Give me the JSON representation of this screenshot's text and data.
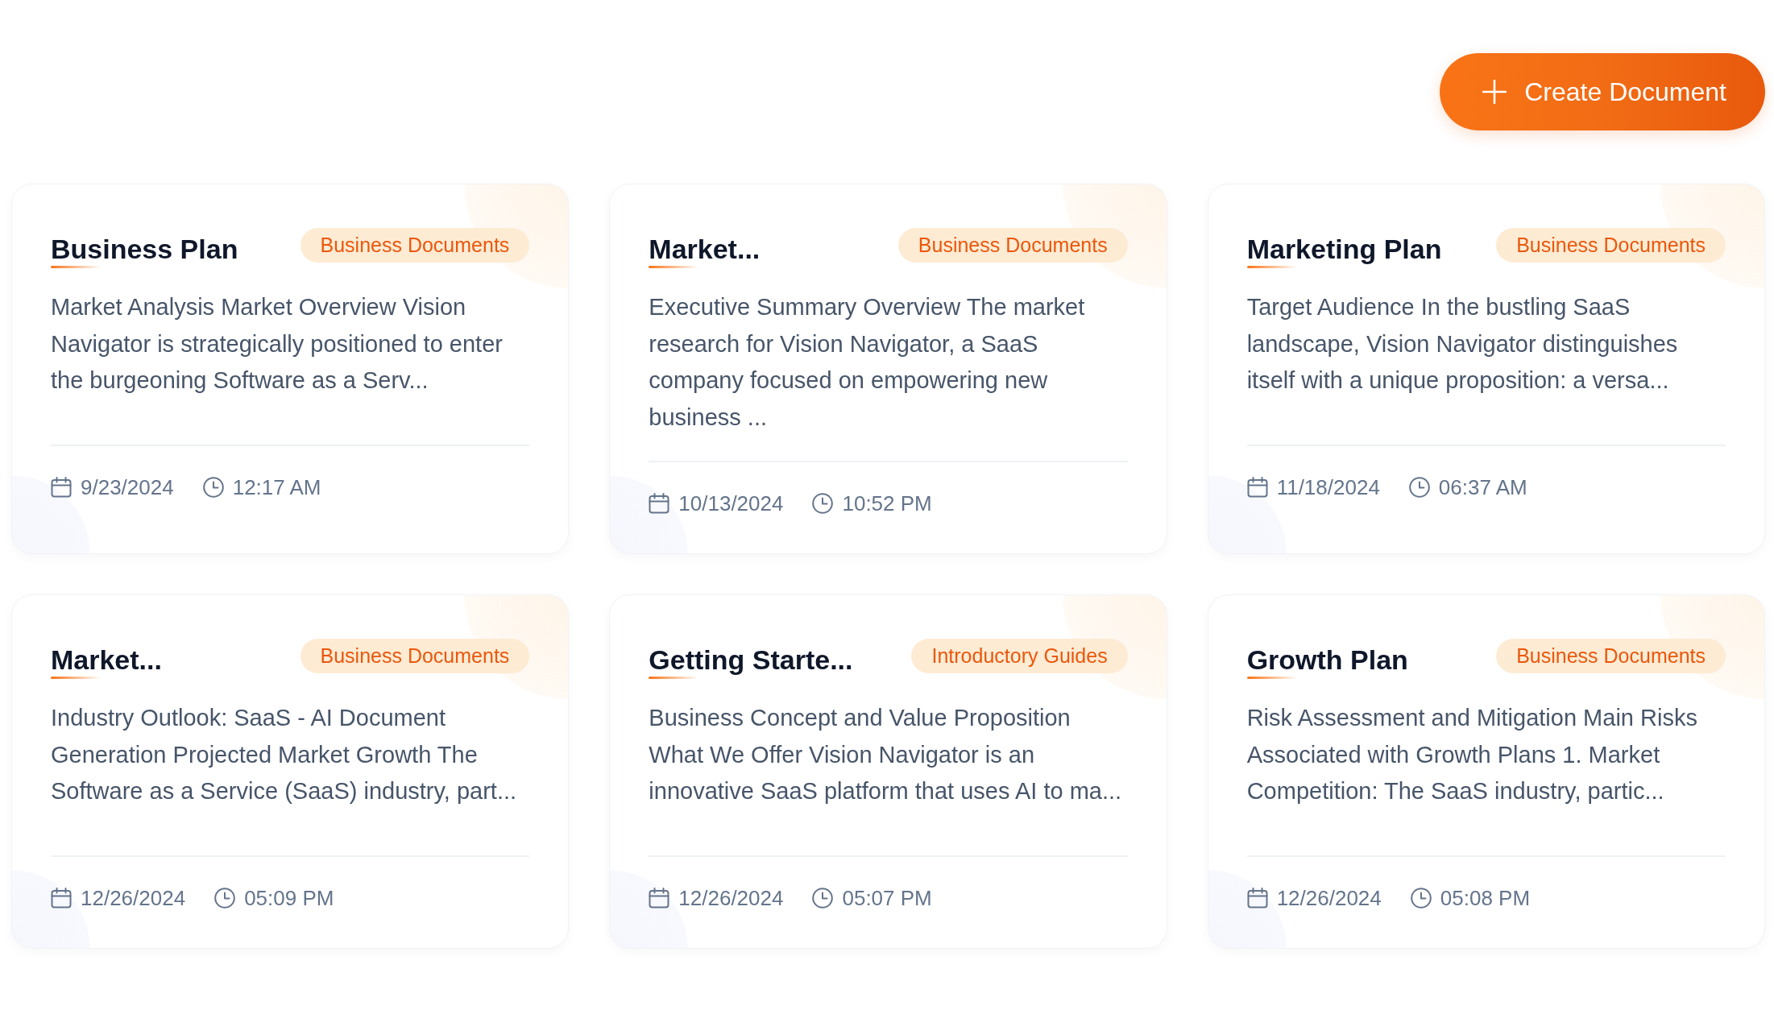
{
  "toolbar": {
    "create_button": {
      "label": "Create Document"
    }
  },
  "documents": [
    {
      "title": "Business Plan",
      "category": "Business Documents",
      "excerpt": "Market Analysis Market Overview Vision Navigator is strategically positioned to enter the burgeoning Software as a Serv...",
      "date": "9/23/2024",
      "time": "12:17 AM"
    },
    {
      "title": "Market...",
      "category": "Business Documents",
      "excerpt": "Executive Summary Overview The market research for Vision Navigator, a SaaS company focused on empowering new business ...",
      "date": "10/13/2024",
      "time": "10:52 PM"
    },
    {
      "title": "Marketing Plan",
      "category": "Business Documents",
      "excerpt": "Target Audience In the bustling SaaS landscape, Vision Navigator distinguishes itself with a unique proposition: a versa...",
      "date": "11/18/2024",
      "time": "06:37 AM"
    },
    {
      "title": "Market...",
      "category": "Business Documents",
      "excerpt": "Industry Outlook: SaaS - AI Document Generation Projected Market Growth The Software as a Service (SaaS) industry, part...",
      "date": "12/26/2024",
      "time": "05:09 PM"
    },
    {
      "title": "Getting Starte...",
      "category": "Introductory Guides",
      "excerpt": "Business Concept and Value Proposition What We Offer Vision Navigator is an innovative SaaS platform that uses AI to ma...",
      "date": "12/26/2024",
      "time": "05:07 PM"
    },
    {
      "title": "Growth Plan",
      "category": "Business Documents",
      "excerpt": "Risk Assessment and Mitigation Main Risks Associated with Growth Plans 1. Market Competition: The SaaS industry, partic...",
      "date": "12/26/2024",
      "time": "05:08 PM"
    }
  ]
}
